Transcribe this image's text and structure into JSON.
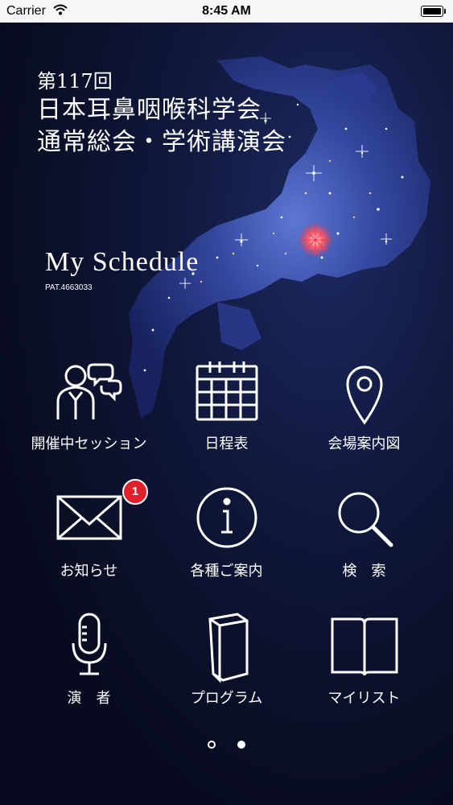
{
  "status_bar": {
    "carrier": "Carrier",
    "time": "8:45 AM"
  },
  "header": {
    "line1": "第117回",
    "line2": "日本耳鼻咽喉科学会",
    "line3": "通常総会・学術講演会"
  },
  "my_schedule": {
    "title": "My Schedule",
    "patent": "PAT.4663033"
  },
  "menu": [
    {
      "label": "開催中セッション",
      "icon": "people-talking-icon"
    },
    {
      "label": "日程表",
      "icon": "calendar-icon"
    },
    {
      "label": "会場案内図",
      "icon": "map-pin-icon"
    },
    {
      "label": "お知らせ",
      "icon": "envelope-icon",
      "badge": "1"
    },
    {
      "label": "各種ご案内",
      "icon": "info-icon"
    },
    {
      "label": "検　索",
      "icon": "search-icon"
    },
    {
      "label": "演　者",
      "icon": "microphone-icon"
    },
    {
      "label": "プログラム",
      "icon": "book-icon"
    },
    {
      "label": "マイリスト",
      "icon": "open-book-icon"
    }
  ],
  "pager": {
    "pages": 2,
    "current": 2
  },
  "colors": {
    "background": "#0a0e24",
    "badge": "#e0202a",
    "map_glow": "#4a63c9",
    "highlight": "#e8364a"
  }
}
